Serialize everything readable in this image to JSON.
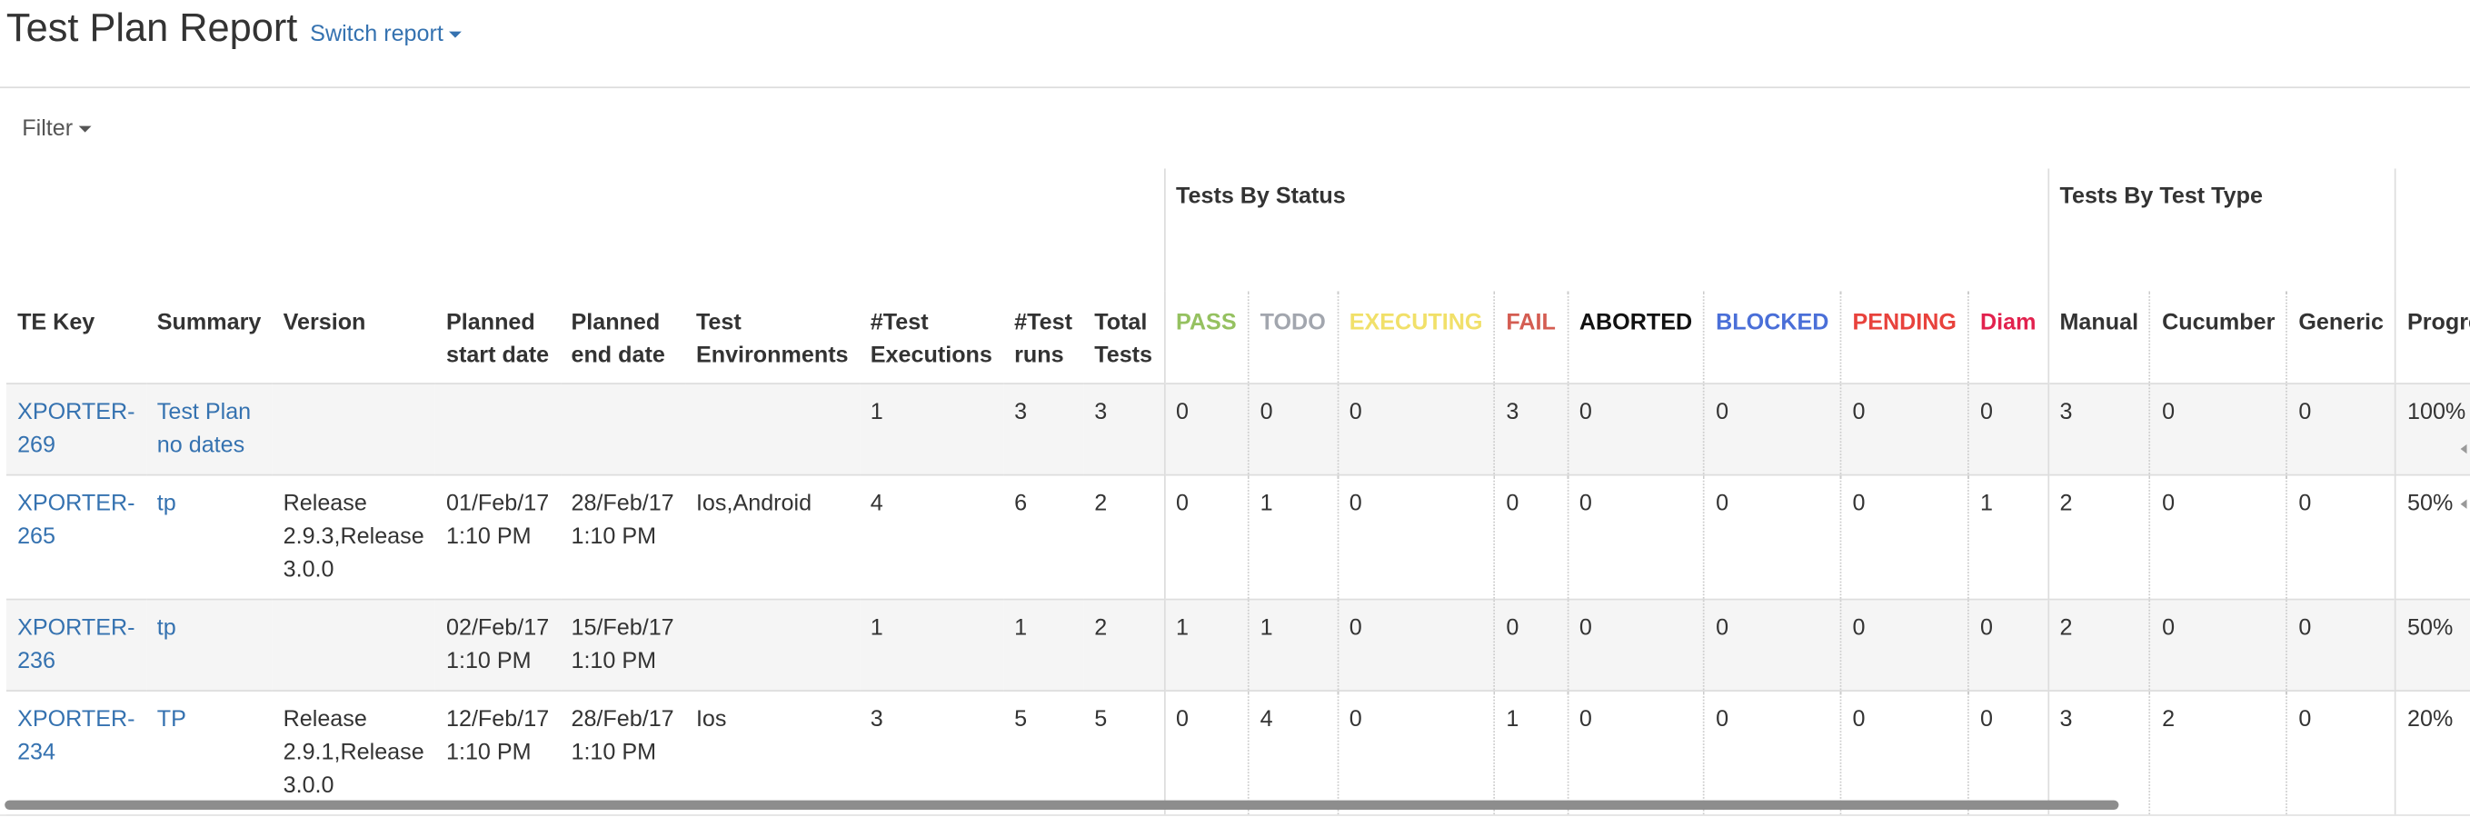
{
  "header": {
    "title": "Test Plan Report",
    "switch_label": "Switch report"
  },
  "filter": {
    "label": "Filter"
  },
  "table": {
    "group_headers": {
      "status": "Tests By Status",
      "type": "Tests By Test Type"
    },
    "columns": {
      "te_key": "TE Key",
      "summary": "Summary",
      "version": "Version",
      "planned_start": "Planned start date",
      "planned_end": "Planned end date",
      "test_env": "Test Environments",
      "test_exec": "#Test Executions",
      "test_runs": "#Test runs",
      "total_tests": "Total Tests",
      "pass": "PASS",
      "todo": "TODO",
      "executing": "EXECUTING",
      "fail": "FAIL",
      "aborted": "ABORTED",
      "blocked": "BLOCKED",
      "pending": "PENDING",
      "diam": "Diam",
      "manual": "Manual",
      "cucumber": "Cucumber",
      "generic": "Generic",
      "progress": "Progre"
    },
    "status_colors": {
      "pass": "#95c160",
      "todo": "#a2a6ae",
      "executing": "#f1e069",
      "fail": "#d45d52",
      "aborted": "#111111",
      "blocked": "#4a6fd8",
      "pending": "#e8423c",
      "diam": "#e2224e"
    },
    "rows": [
      {
        "te_key": "XPORTER-269",
        "summary": "Test Plan no dates",
        "version": "",
        "planned_start": "",
        "planned_end": "",
        "test_env": "",
        "test_exec": "1",
        "test_runs": "3",
        "total_tests": "3",
        "pass": "0",
        "todo": "0",
        "executing": "0",
        "fail": "3",
        "aborted": "0",
        "blocked": "0",
        "pending": "0",
        "diam": "0",
        "manual": "3",
        "cucumber": "0",
        "generic": "0",
        "progress": "100%"
      },
      {
        "te_key": "XPORTER-265",
        "summary": "tp",
        "version": "Release 2.9.3,Release 3.0.0",
        "planned_start": "01/Feb/17 1:10 PM",
        "planned_end": "28/Feb/17 1:10 PM",
        "test_env": "Ios,Android",
        "test_exec": "4",
        "test_runs": "6",
        "total_tests": "2",
        "pass": "0",
        "todo": "1",
        "executing": "0",
        "fail": "0",
        "aborted": "0",
        "blocked": "0",
        "pending": "0",
        "diam": "1",
        "manual": "2",
        "cucumber": "0",
        "generic": "0",
        "progress": "50%"
      },
      {
        "te_key": "XPORTER-236",
        "summary": "tp",
        "version": "",
        "planned_start": "02/Feb/17 1:10 PM",
        "planned_end": "15/Feb/17 1:10 PM",
        "test_env": "",
        "test_exec": "1",
        "test_runs": "1",
        "total_tests": "2",
        "pass": "1",
        "todo": "1",
        "executing": "0",
        "fail": "0",
        "aborted": "0",
        "blocked": "0",
        "pending": "0",
        "diam": "0",
        "manual": "2",
        "cucumber": "0",
        "generic": "0",
        "progress": "50%"
      },
      {
        "te_key": "XPORTER-234",
        "summary": "TP",
        "version": "Release 2.9.1,Release 3.0.0",
        "planned_start": "12/Feb/17 1:10 PM",
        "planned_end": "28/Feb/17 1:10 PM",
        "test_env": "Ios",
        "test_exec": "3",
        "test_runs": "5",
        "total_tests": "5",
        "pass": "0",
        "todo": "4",
        "executing": "0",
        "fail": "1",
        "aborted": "0",
        "blocked": "0",
        "pending": "0",
        "diam": "0",
        "manual": "3",
        "cucumber": "2",
        "generic": "0",
        "progress": "20%"
      }
    ]
  }
}
